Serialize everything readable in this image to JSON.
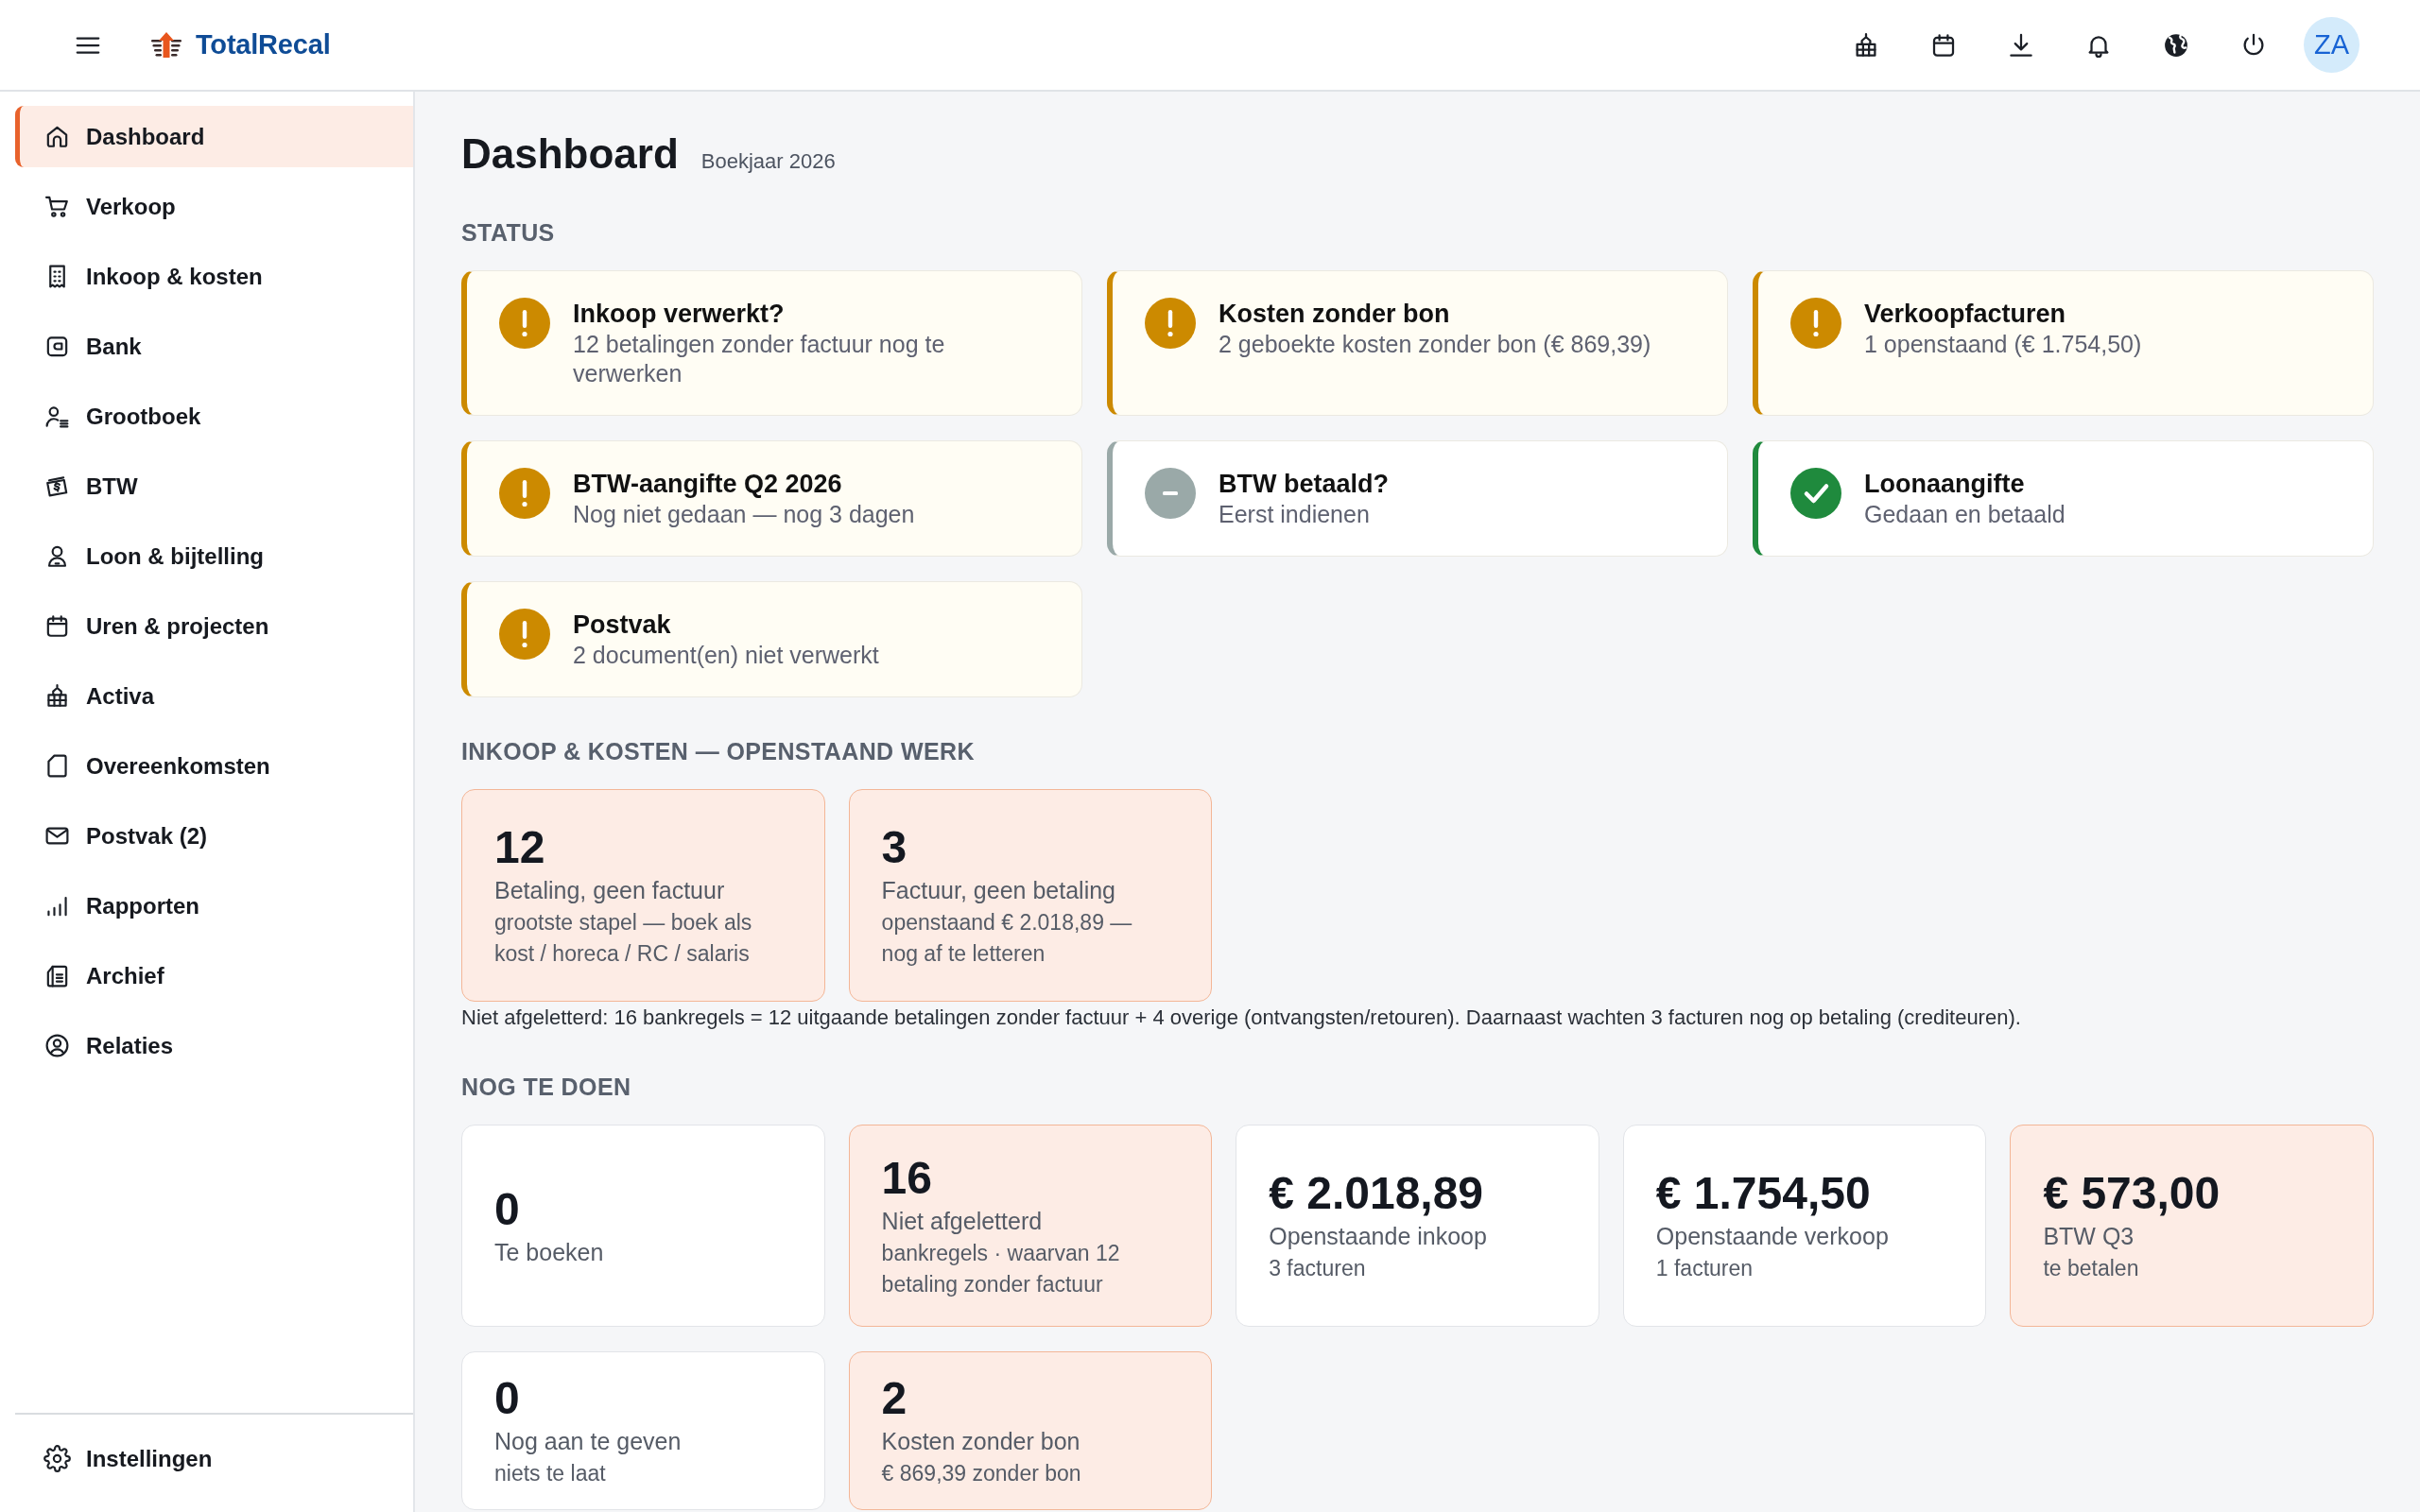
{
  "topbar": {
    "brand": "TotalRecal",
    "avatar": "ZA"
  },
  "sidebar": {
    "items": [
      {
        "label": "Dashboard",
        "selected": true
      },
      {
        "label": "Verkoop",
        "selected": false
      },
      {
        "label": "Inkoop & kosten",
        "selected": false
      },
      {
        "label": "Bank",
        "selected": false
      },
      {
        "label": "Grootboek",
        "selected": false
      },
      {
        "label": "BTW",
        "selected": false
      },
      {
        "label": "Loon & bijtelling",
        "selected": false
      },
      {
        "label": "Uren & projecten",
        "selected": false
      },
      {
        "label": "Activa",
        "selected": false
      },
      {
        "label": "Overeenkomsten",
        "selected": false
      },
      {
        "label": "Postvak (2)",
        "selected": false
      },
      {
        "label": "Rapporten",
        "selected": false
      },
      {
        "label": "Archief",
        "selected": false
      },
      {
        "label": "Relaties",
        "selected": false
      }
    ],
    "bottom_items": [
      {
        "label": "Instellingen",
        "selected": false
      }
    ]
  },
  "page": {
    "title": "Dashboard",
    "subtitle": "Boekjaar 2026"
  },
  "status": {
    "heading": "STATUS",
    "items": [
      {
        "kind": "warning",
        "title": "Inkoop verwerkt?",
        "text": "12 betalingen zonder factuur nog te verwerken"
      },
      {
        "kind": "warning",
        "title": "Kosten zonder bon",
        "text": "2 geboekte kosten zonder bon (€ 869,39)"
      },
      {
        "kind": "warning",
        "title": "Verkoopfacturen",
        "text": "1 openstaand (€ 1.754,50)"
      },
      {
        "kind": "warning",
        "title": "BTW-aangifte Q2 2026",
        "text": "Nog niet gedaan — nog 3 dagen"
      },
      {
        "kind": "pending",
        "title": "BTW betaald?",
        "text": "Eerst indienen"
      },
      {
        "kind": "done",
        "title": "Loonaangifte",
        "text": "Gedaan en betaald"
      },
      {
        "kind": "warning",
        "title": "Postvak",
        "text": "2 document(en) niet verwerkt"
      }
    ]
  },
  "open_work": {
    "heading": "INKOOP & KOSTEN — OPENSTAAND WERK",
    "cards": [
      {
        "value": "12",
        "label": "Betaling, geen factuur",
        "detail": "grootste stapel — boek als kost / horeca / RC / salaris",
        "highlighted": true
      },
      {
        "value": "3",
        "label": "Factuur, geen betaling",
        "detail": "openstaand € 2.018,89 — nog af te letteren",
        "highlighted": true
      }
    ],
    "note": "Niet afgeletterd: 16 bankregels = 12 uitgaande betalingen zonder factuur + 4 overige (ontvangsten/retouren). Daarnaast wachten 3 facturen nog op betaling (crediteuren)."
  },
  "todo": {
    "heading": "NOG TE DOEN",
    "cards": [
      {
        "value": "0",
        "label": "Te boeken",
        "highlighted": false
      },
      {
        "value": "16",
        "label": "Niet afgeletterd",
        "detail": "bankregels · waarvan 12 betaling zonder factuur",
        "highlighted": true
      },
      {
        "value": "€ 2.018,89",
        "label": "Openstaande inkoop",
        "detail": "3 facturen",
        "highlighted": false
      },
      {
        "value": "€ 1.754,50",
        "label": "Openstaande verkoop",
        "detail": "1 facturen",
        "highlighted": false
      },
      {
        "value": "€ 573,00",
        "label": "BTW Q3",
        "detail": "te betalen",
        "highlighted": true
      },
      {
        "value": "0",
        "label": "Nog aan te geven",
        "detail": "niets te laat",
        "highlighted": false
      },
      {
        "value": "2",
        "label": "Kosten zonder bon",
        "detail": "€ 869,39 zonder bon",
        "highlighted": true
      }
    ]
  }
}
